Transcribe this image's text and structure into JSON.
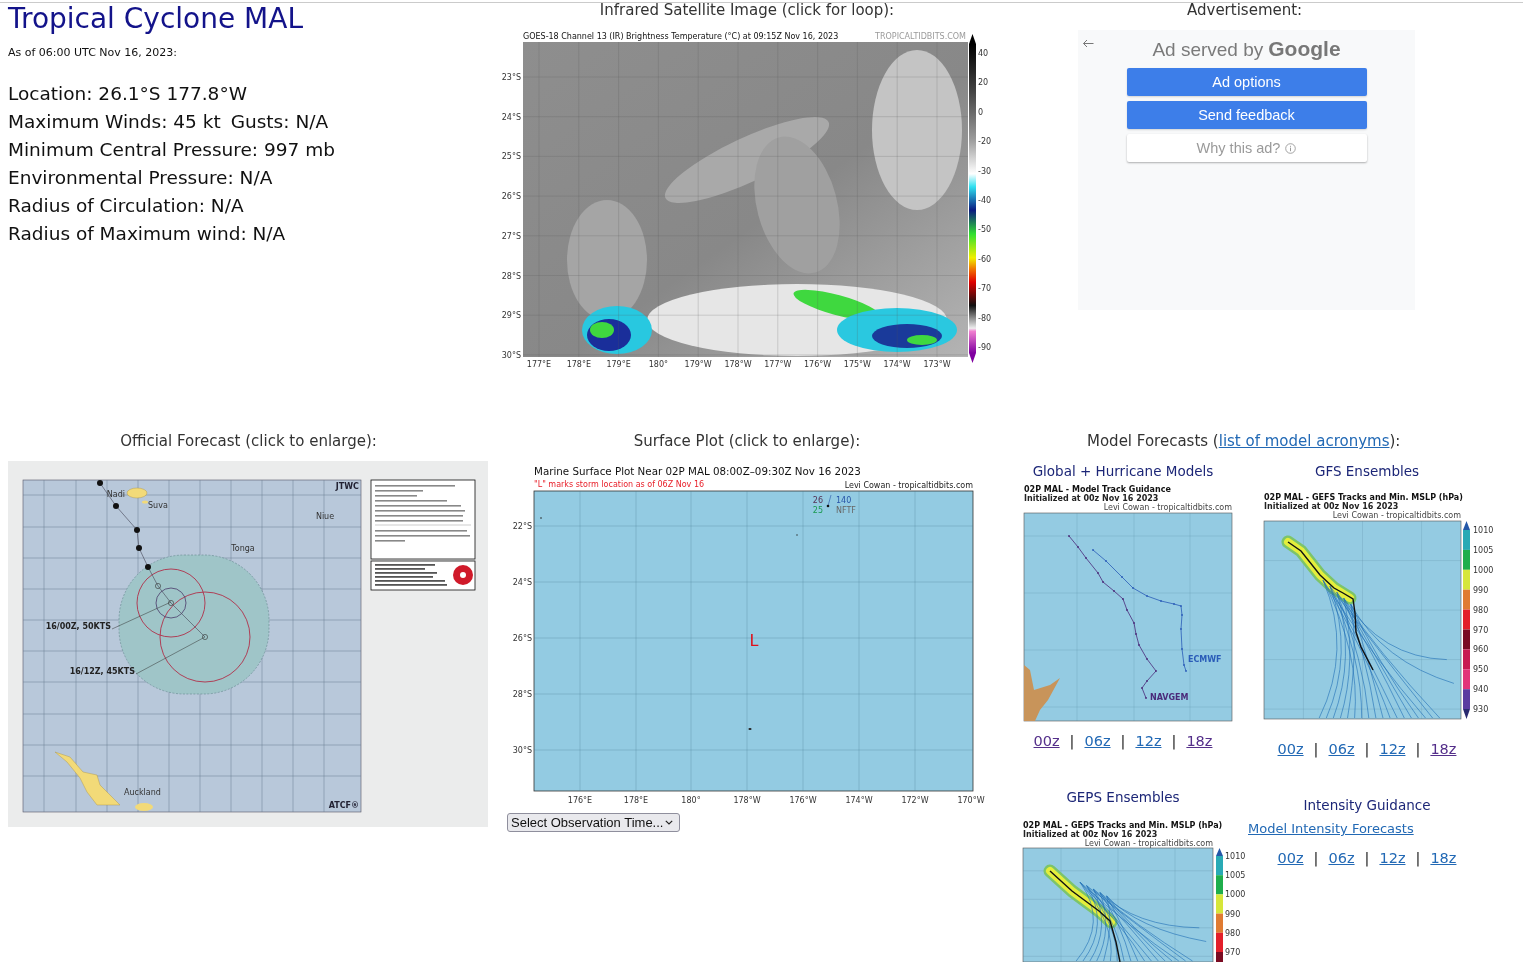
{
  "storm": {
    "title": "Tropical Cyclone MAL",
    "as_of": "As of 06:00 UTC Nov 16, 2023:",
    "details": [
      [
        "Location: 26.1°S 177.8°W"
      ],
      [
        "Maximum Winds: 45 kt",
        "Gusts: N/A"
      ],
      [
        "Minimum Central Pressure: 997 mb"
      ],
      [
        "Environmental Pressure: N/A"
      ],
      [
        "Radius of Circulation: N/A"
      ],
      [
        "Radius of Maximum wind: N/A"
      ]
    ]
  },
  "satellite": {
    "heading": "Infrared Satellite Image (click for loop):",
    "title": "GOES-18 Channel 13 (IR) Brightness Temperature (°C) at 09:15Z Nov 16, 2023",
    "credit": "TROPICALTIDBITS.COM",
    "lat_ticks": [
      "23°S",
      "24°S",
      "25°S",
      "26°S",
      "27°S",
      "28°S",
      "29°S",
      "30°S"
    ],
    "lon_ticks": [
      "177°E",
      "178°E",
      "179°E",
      "180°",
      "179°W",
      "178°W",
      "177°W",
      "176°W",
      "175°W",
      "174°W",
      "173°W"
    ],
    "scale_ticks": [
      "40",
      "20",
      "0",
      "-20",
      "-30",
      "-40",
      "-50",
      "-60",
      "-70",
      "-80",
      "-90"
    ]
  },
  "advertisement": {
    "heading": "Advertisement:",
    "served_by": "Ad served by",
    "logo": "Google",
    "buttons": [
      {
        "label": "Ad options",
        "kind": "primary"
      },
      {
        "label": "Send feedback",
        "kind": "primary"
      },
      {
        "label": "Why this ad?",
        "kind": "info"
      }
    ]
  },
  "official_forecast": {
    "heading": "Official Forecast (click to enlarge):",
    "agency": "JTWC",
    "system": "ATCF®",
    "places": [
      "Nadi",
      "Suva",
      "Niue",
      "Tonga",
      "Auckland"
    ],
    "labels": [
      "16/00Z, 50KTS",
      "16/12Z, 45KTS"
    ]
  },
  "surface_plot": {
    "heading": "Surface Plot (click to enlarge):",
    "title": "Marine Surface Plot Near 02P MAL 08:00Z–09:30Z Nov 16 2023",
    "note": "\"L\" marks storm location as of 06Z Nov 16",
    "credit": "Levi Cowan - tropicaltidbits.com",
    "storm_marker": "L",
    "station": [
      "26",
      "140",
      "25",
      "NFTF"
    ],
    "lat_ticks": [
      "22°S",
      "24°S",
      "26°S",
      "28°S",
      "30°S"
    ],
    "lon_ticks": [
      "176°E",
      "178°E",
      "180°",
      "178°W",
      "176°W",
      "174°W",
      "172°W",
      "170°W"
    ],
    "select": {
      "value": "Select Observation Time..."
    }
  },
  "model_forecasts": {
    "heading": {
      "before": "Model Forecasts (",
      "link": "list of model acronyms",
      "after": "):"
    },
    "separator": "|",
    "panels": [
      {
        "kind": "tracks",
        "title": "Global + Hurricane Models",
        "image_title": "02P MAL - Model Track Guidance",
        "initialized": "Initialized at 00z Nov 16 2023",
        "credit": "Levi Cowan - tropicaltidbits.com",
        "model_labels": [
          "ECMWF",
          "NAVGEM"
        ],
        "runs": [
          {
            "label": "00z",
            "visited": true
          },
          {
            "label": "06z",
            "visited": false
          },
          {
            "label": "12z",
            "visited": false
          },
          {
            "label": "18z",
            "visited": true
          }
        ]
      },
      {
        "kind": "ensemble",
        "title": "GFS Ensembles",
        "image_title": "02P MAL - GEFS Tracks and Min. MSLP (hPa)",
        "initialized": "Initialized at 00z Nov 16 2023",
        "credit": "Levi Cowan - tropicaltidbits.com",
        "scale_ticks": [
          "1010",
          "1005",
          "1000",
          "990",
          "980",
          "970",
          "960",
          "950",
          "940",
          "930"
        ],
        "runs": [
          {
            "label": "00z",
            "visited": false
          },
          {
            "label": "06z",
            "visited": false
          },
          {
            "label": "12z",
            "visited": false
          },
          {
            "label": "18z",
            "visited": true
          }
        ]
      },
      {
        "kind": "ensemble",
        "title": "GEPS Ensembles",
        "image_title": "02P MAL - GEPS Tracks and Min. MSLP (hPa)",
        "initialized": "Initialized at 00z Nov 16 2023",
        "credit": "Levi Cowan - tropicaltidbits.com",
        "scale_ticks": [
          "1010",
          "1005",
          "1000",
          "990",
          "980",
          "970"
        ]
      },
      {
        "kind": "intensity",
        "title": "Intensity Guidance",
        "link": "Model Intensity Forecasts",
        "runs": [
          {
            "label": "00z",
            "visited": false
          },
          {
            "label": "06z",
            "visited": false
          },
          {
            "label": "12z",
            "visited": false
          },
          {
            "label": "18z",
            "visited": false
          }
        ]
      }
    ]
  }
}
